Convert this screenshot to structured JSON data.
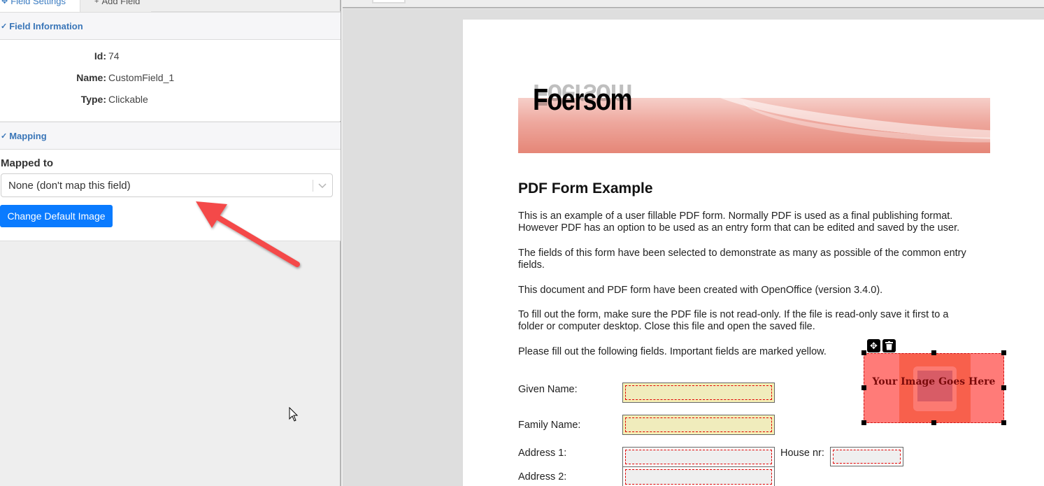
{
  "left_panel": {
    "tabs": [
      {
        "label": "Field Settings",
        "icon": "move-icon",
        "active": true
      },
      {
        "label": "Add Field",
        "icon": "plus-icon",
        "active": false
      }
    ],
    "field_information": {
      "title": "Field Information",
      "rows": [
        {
          "label": "Id:",
          "value": "74"
        },
        {
          "label": "Name:",
          "value": "CustomField_1"
        },
        {
          "label": "Type:",
          "value": "Clickable"
        }
      ]
    },
    "mapping": {
      "title": "Mapping",
      "mapped_to_label": "Mapped to",
      "selected_option": "None (don't map this field)",
      "change_image_button": "Change Default Image"
    }
  },
  "document": {
    "brand": "Foersom",
    "title": "PDF Form Example",
    "paragraphs": [
      "This is an example of a user fillable PDF form. Normally PDF is used as a final publishing format. However PDF has an option to be used as an entry form that can be edited and saved by the user.",
      "The fields of this form have been selected to demonstrate as many as possible of the common entry fields.",
      "This document and PDF form have been created with OpenOffice (version 3.4.0).",
      "To fill out the form, make sure the PDF file is not read-only. If the file is read-only save it first to a folder or computer desktop. Close this file and open the saved file.",
      "Please fill out the following fields. Important fields are marked yellow."
    ],
    "form_fields": [
      {
        "label": "Given Name:",
        "value": "",
        "important": true
      },
      {
        "label": "Family Name:",
        "value": "",
        "important": true
      },
      {
        "label": "Address 1:",
        "value": "",
        "important": false
      },
      {
        "label": "House nr:",
        "value": "",
        "important": false
      },
      {
        "label": "Address 2:",
        "value": "",
        "important": false
      }
    ],
    "image_field": {
      "placeholder_text": "Your Image Goes Here",
      "tools": [
        "move-icon",
        "trash-icon"
      ]
    }
  },
  "colors": {
    "accent_blue": "#0a7bff",
    "section_title": "#3a76b8",
    "important_field": "#f5f0b5",
    "image_field": "#ff7b78",
    "annotation_arrow": "#f44848"
  }
}
